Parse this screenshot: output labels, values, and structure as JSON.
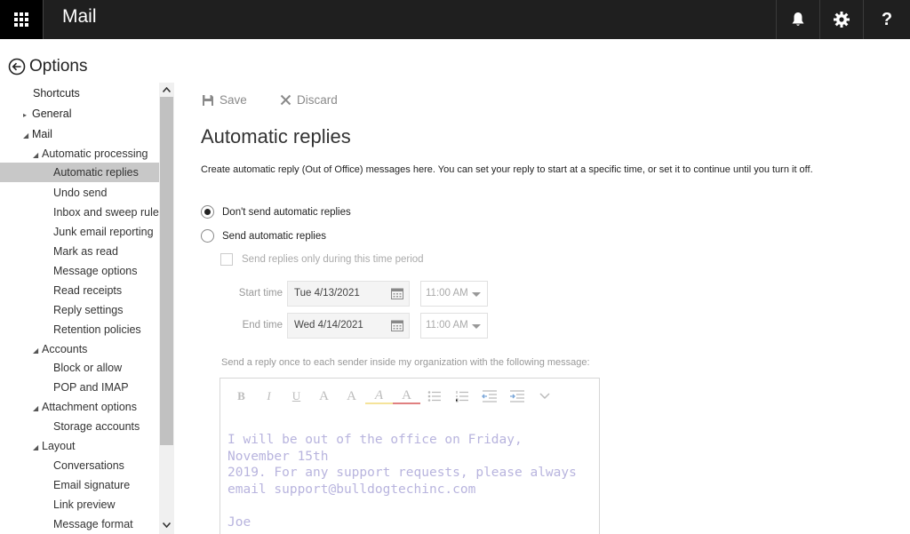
{
  "topbar": {
    "app_title": "Mail",
    "help_label": "?",
    "icons": [
      "app-launcher-icon",
      "bell-icon",
      "gear-icon",
      "help-icon"
    ]
  },
  "options": {
    "title": "Options"
  },
  "nav": {
    "shortcuts": "Shortcuts",
    "general": "General",
    "mail": "Mail",
    "automatic_processing": "Automatic processing",
    "automatic_replies": "Automatic replies",
    "undo_send": "Undo send",
    "inbox_sweep": "Inbox and sweep rules",
    "junk": "Junk email reporting",
    "mark_read": "Mark as read",
    "message_options": "Message options",
    "read_receipts": "Read receipts",
    "reply_settings": "Reply settings",
    "retention": "Retention policies",
    "accounts": "Accounts",
    "block_allow": "Block or allow",
    "pop_imap": "POP and IMAP",
    "attachment_options": "Attachment options",
    "storage_accounts": "Storage accounts",
    "layout": "Layout",
    "conversations": "Conversations",
    "email_signature": "Email signature",
    "link_preview": "Link preview",
    "message_format": "Message format"
  },
  "commands": {
    "save": "Save",
    "discard": "Discard"
  },
  "page": {
    "title": "Automatic replies",
    "description": "Create automatic reply (Out of Office) messages here. You can set your reply to start at a specific time, or set it to continue until you turn it off.",
    "radio_dont": "Don't send automatic replies",
    "radio_send": "Send automatic replies",
    "selected_option": "dont_send",
    "check_period": "Send replies only during this time period",
    "start_label": "Start time",
    "start_date": "Tue 4/13/2021",
    "start_time": "11:00 AM",
    "end_label": "End time",
    "end_date": "Wed 4/14/2021",
    "end_time": "11:00 AM",
    "inside_label": "Send a reply once to each sender inside my organization with the following message:"
  },
  "editor": {
    "toolbar": {
      "bold": "B",
      "italic": "I",
      "underline": "U",
      "font_size": "A",
      "grow_font": "A",
      "highlight": "A",
      "font_color": "A"
    },
    "line1": "I will be out of the office on Friday, November 15th",
    "line2": "2019. For any support requests, please always",
    "line3": "email support@bulldogtechinc.com",
    "signature": "Joe"
  }
}
